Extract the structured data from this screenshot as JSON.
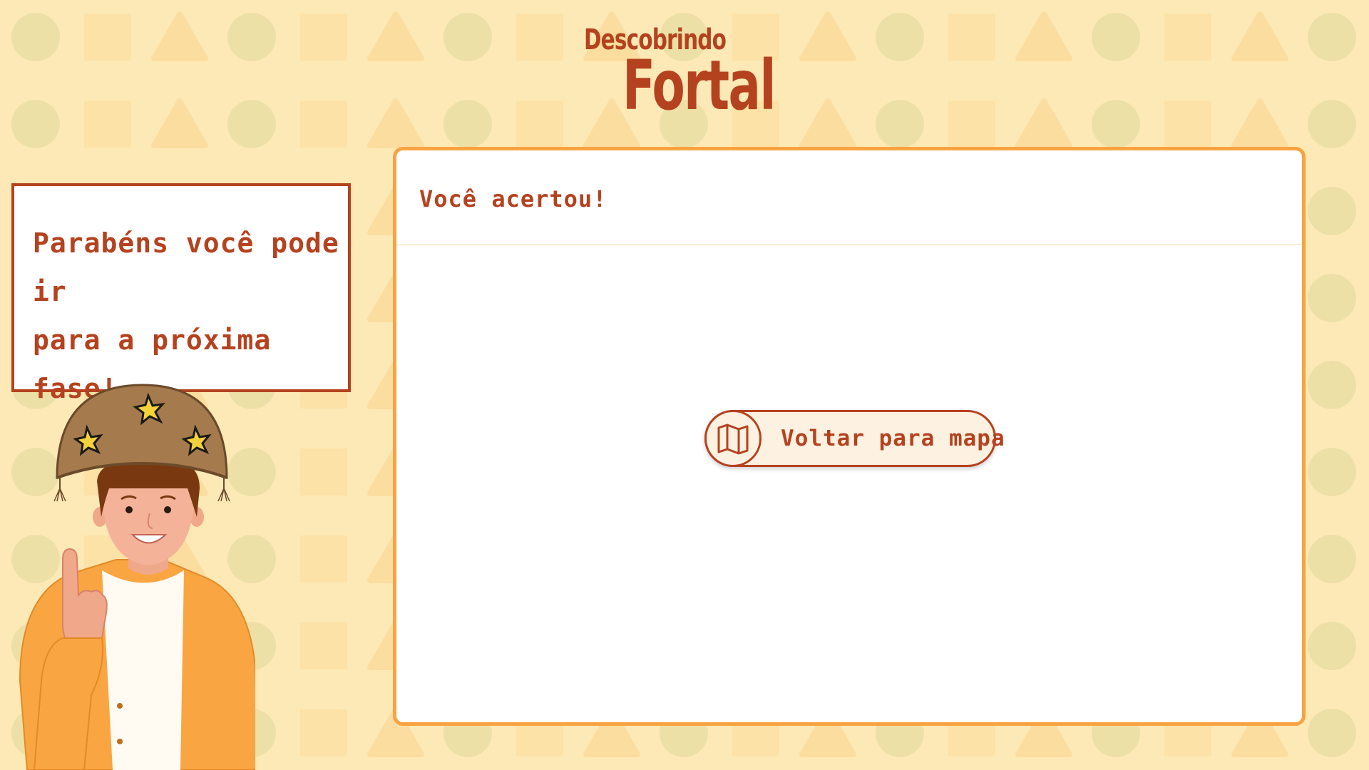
{
  "logo": {
    "line1": "Descobrindo",
    "line2": "Fortal"
  },
  "speech": {
    "line1": "Parabéns você pode ir",
    "line2": "para a próxima fase!"
  },
  "card": {
    "title": "Você acertou!",
    "button_label": "Voltar para mapa",
    "button_icon": "map-icon"
  },
  "colors": {
    "background": "#fde9b6",
    "accent_orange": "#f7a341",
    "text_brown": "#b5421f",
    "card_bg": "#ffffff"
  }
}
